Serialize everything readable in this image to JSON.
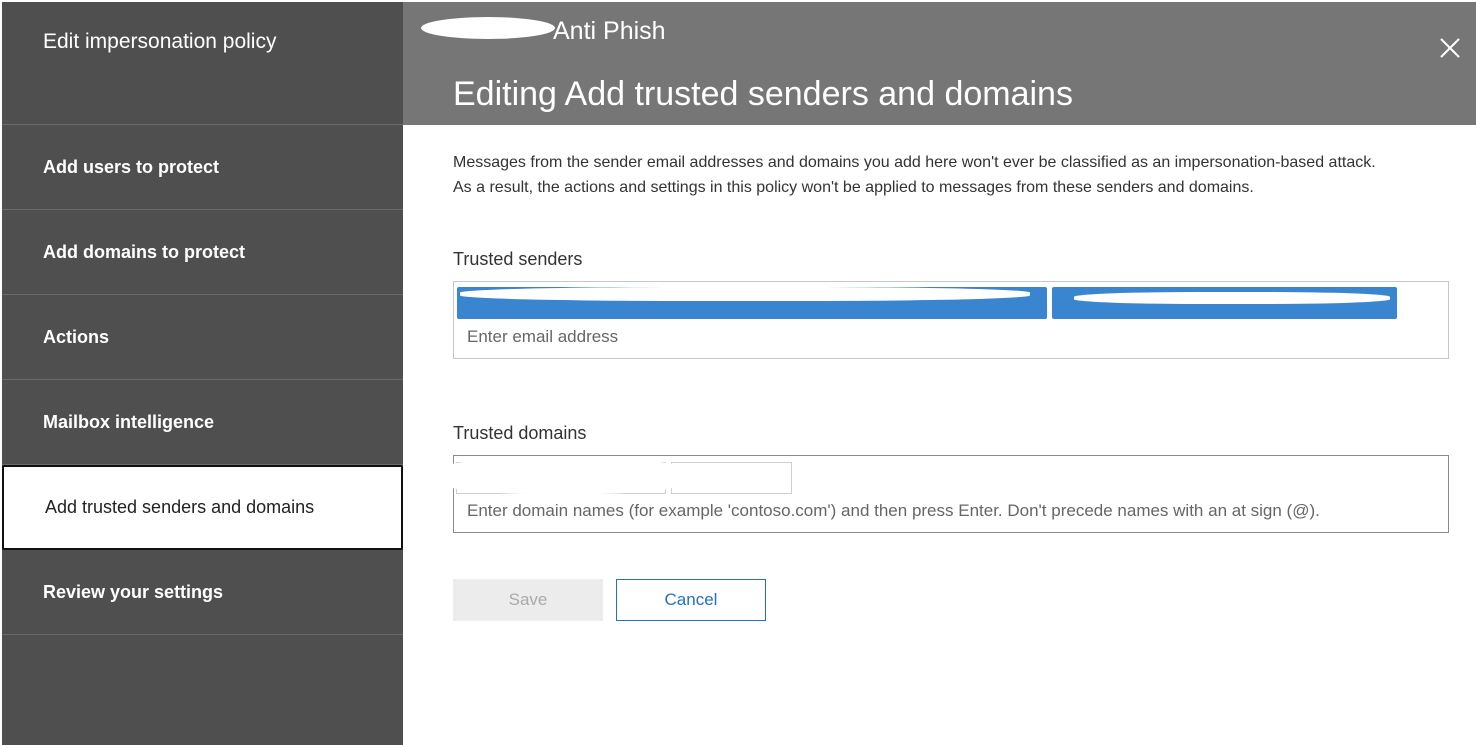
{
  "sidebar": {
    "header": "Edit impersonation policy",
    "items": [
      {
        "label": "Add users to protect"
      },
      {
        "label": "Add domains to protect"
      },
      {
        "label": "Actions"
      },
      {
        "label": "Mailbox intelligence"
      },
      {
        "label": "Add trusted senders and domains",
        "active": true
      },
      {
        "label": "Review your settings"
      }
    ]
  },
  "header": {
    "policy_name": "Anti Phish",
    "title": "Editing Add trusted senders and domains",
    "close_icon": "close-icon"
  },
  "main": {
    "description_line1": "Messages from the sender email addresses and domains you add here won't ever be classified as an impersonation-based attack.",
    "description_line2": "As a result, the actions and settings in this policy won't be applied to messages from these senders and domains.",
    "trusted_senders": {
      "label": "Trusted senders",
      "placeholder": "Enter email address"
    },
    "trusted_domains": {
      "label": "Trusted domains",
      "placeholder": "Enter domain names (for example 'contoso.com') and then press Enter. Don't precede names with an at sign (@)."
    },
    "buttons": {
      "save": "Save",
      "cancel": "Cancel"
    }
  },
  "colors": {
    "sidebar_bg": "#4f4f4f",
    "header_bg": "#767676",
    "chip_blue": "#3a85cf",
    "accent_blue": "#2470c4"
  }
}
